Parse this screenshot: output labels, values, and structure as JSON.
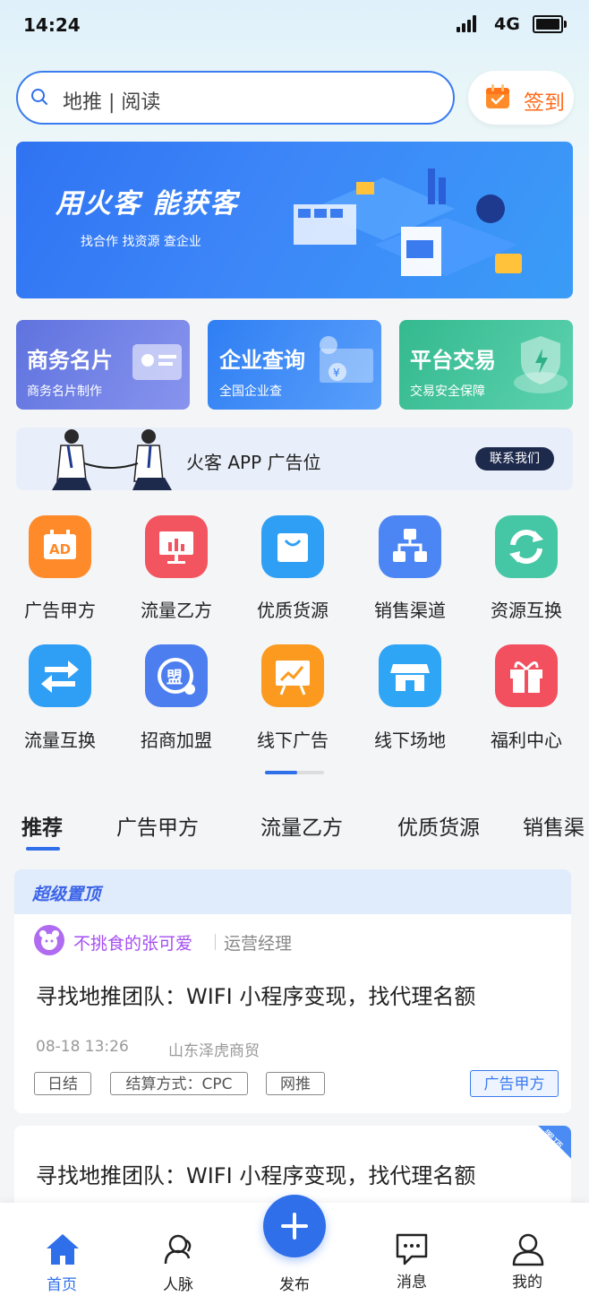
{
  "status_bar": {
    "time": "14:24",
    "network": "4G"
  },
  "search": {
    "text": "地推 | 阅读",
    "checkin_label": "签到"
  },
  "banner": {
    "title": "用火客  能获客",
    "subtitle": "找合作  找资源  查企业"
  },
  "feature_cards": [
    {
      "title": "商务名片",
      "subtitle": "商务名片制作",
      "color": "#6d7fe6"
    },
    {
      "title": "企业查询",
      "subtitle": "全国企业查",
      "color": "#3d88f5"
    },
    {
      "title": "平台交易",
      "subtitle": "交易安全保障",
      "color": "#3fc29e"
    }
  ],
  "ad": {
    "text": "火客 APP 广告位",
    "button": "联系我们"
  },
  "grid": [
    {
      "label": "广告甲方",
      "icon": "ad-board-icon",
      "color": "#ff8a2a"
    },
    {
      "label": "流量乙方",
      "icon": "presentation-chart-icon",
      "color": "#f2555f"
    },
    {
      "label": "优质货源",
      "icon": "shopping-bag-icon",
      "color": "#2f9ff5"
    },
    {
      "label": "销售渠道",
      "icon": "hierarchy-icon",
      "color": "#4c86f4"
    },
    {
      "label": "资源互换",
      "icon": "refresh-icon",
      "color": "#45c7a5"
    },
    {
      "label": "流量互换",
      "icon": "swap-arrows-icon",
      "color": "#2f9ff5"
    },
    {
      "label": "招商加盟",
      "icon": "alliance-icon",
      "color": "#4c7ef0"
    },
    {
      "label": "线下广告",
      "icon": "billboard-icon",
      "color": "#fb9a1e"
    },
    {
      "label": "线下场地",
      "icon": "store-icon",
      "color": "#2fa5f5"
    },
    {
      "label": "福利中心",
      "icon": "gift-icon",
      "color": "#f24f5f"
    }
  ],
  "tabs": [
    "推荐",
    "广告甲方",
    "流量乙方",
    "优质货源",
    "销售渠"
  ],
  "super_top_label": "超级置顶",
  "post1": {
    "user": "不挑食的张可爱",
    "role": "运营经理",
    "title": "寻找地推团队：WIFI 小程序变现，找代理名额",
    "time": "08-18 13:26",
    "company": "山东泽虎商贸",
    "tags": [
      "日结",
      "结算方式：CPC",
      "网推"
    ],
    "category": "广告甲方"
  },
  "post2": {
    "title": "寻找地推团队：WIFI 小程序变现，找代理名额",
    "pin": "置顶"
  },
  "bottom_nav": {
    "home": "首页",
    "contacts": "人脉",
    "publish": "发布",
    "messages": "消息",
    "mine": "我的"
  }
}
